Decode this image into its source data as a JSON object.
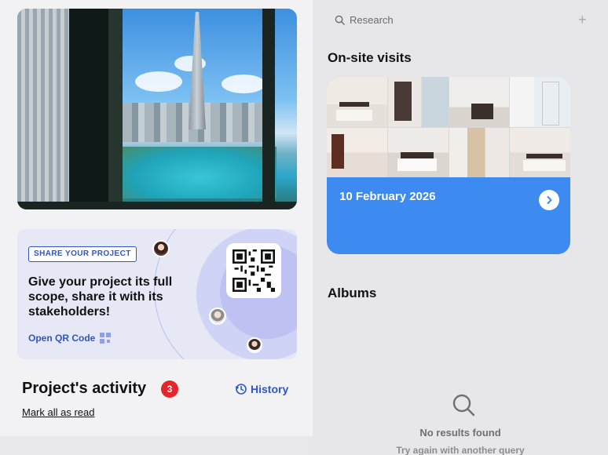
{
  "share_card": {
    "badge": "SHARE YOUR PROJECT",
    "text": "Give your project its full scope, share it with its stakeholders!",
    "open_qr": "Open QR Code"
  },
  "activity": {
    "title": "Project's activity",
    "badge_count": "3",
    "history": "History",
    "mark_all": "Mark all as read"
  },
  "search": {
    "placeholder": "Research"
  },
  "onsite": {
    "title": "On-site visits",
    "date": "10 February 2026"
  },
  "albums": {
    "title": "Albums",
    "empty_title": "No results found",
    "empty_subtitle": "Try again with another query"
  },
  "colors": {
    "accent": "#2f55c9",
    "visit_card": "#3d8af1",
    "badge_red": "#e3262c"
  },
  "icons": {
    "search": "search-icon",
    "plus": "plus-icon",
    "history": "history-icon",
    "chevron": "chevron-right-icon",
    "qr": "qr-code-icon"
  }
}
